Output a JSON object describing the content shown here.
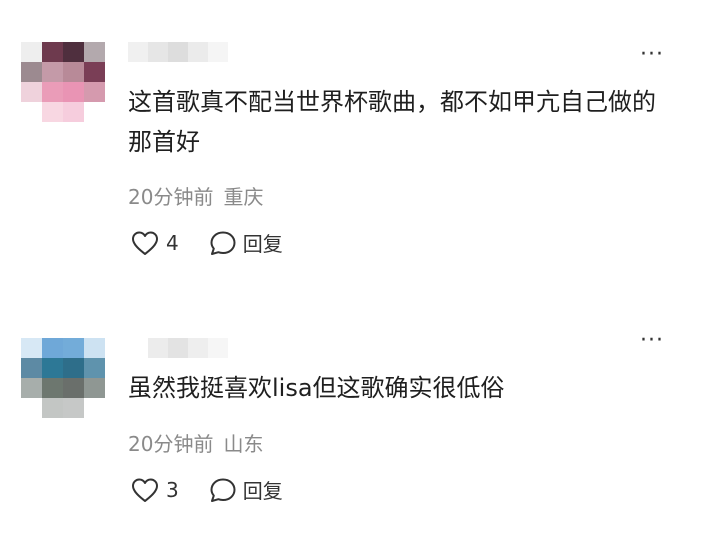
{
  "comments": [
    {
      "text": "这首歌真不配当世界杯歌曲，都不如甲亢自己做的那首好",
      "time": "20分钟前",
      "location": "重庆",
      "likes": "4",
      "reply_label": "回复",
      "more_label": "···",
      "avatar_colors": [
        "#eeeeee",
        "#6e3a4e",
        "#4f2f3e",
        "#b3a9ad",
        "#9c8a90",
        "#c49aa8",
        "#b88a98",
        "#7a3e56",
        "#efd2dc",
        "#ea9cb8",
        "#e994b4",
        "#d59aae",
        "#ffffff",
        "#f8d7e2",
        "#f6cddd",
        "#ffffff"
      ],
      "username_colors": [
        "#f0f0f0",
        "#e6e6e6",
        "#dddddd",
        "#ebebeb",
        "#f5f5f5"
      ]
    },
    {
      "text": "虽然我挺喜欢lisa但这歌确实很低俗",
      "time": "20分钟前",
      "location": "山东",
      "likes": "3",
      "reply_label": "回复",
      "more_label": "···",
      "avatar_colors": [
        "#d7e8f5",
        "#6fa8d8",
        "#73acd9",
        "#cde2f2",
        "#5d8aa4",
        "#2d7896",
        "#2e6e8a",
        "#5f93ad",
        "#a7aeab",
        "#6d776f",
        "#6a6f6b",
        "#8f9793",
        "#ffffff",
        "#c3c6c4",
        "#c6c8c7",
        "#ffffff"
      ],
      "username_colors": [
        "#ffffff",
        "#ececec",
        "#e3e3e3",
        "#eeeeee",
        "#f6f6f6"
      ]
    }
  ]
}
